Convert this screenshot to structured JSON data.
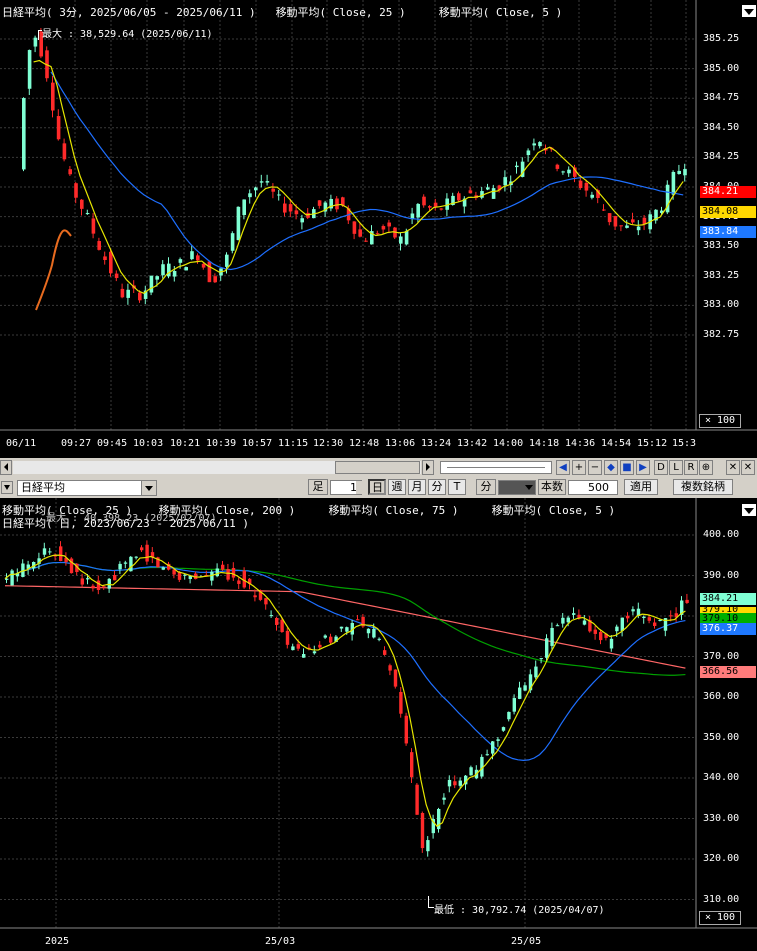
{
  "top_chart": {
    "legend": {
      "instrument": "日経平均( 3分, 2025/06/05 - 2025/06/11 )",
      "ma1": "移動平均( Close, 25 )",
      "ma2": "移動平均( Close, 5 )"
    },
    "max_annotation": "最大 : 38,529.64 (2025/06/11)",
    "y_ticks": [
      "385.25",
      "385.00",
      "384.75",
      "384.50",
      "384.25",
      "384.00",
      "383.75",
      "383.50",
      "383.25",
      "383.00",
      "382.75"
    ],
    "x_ticks": [
      "06/11",
      "09:27",
      "09:45",
      "10:03",
      "10:21",
      "10:39",
      "10:57",
      "11:15",
      "12:30",
      "12:48",
      "13:06",
      "13:24",
      "13:42",
      "14:00",
      "14:18",
      "14:36",
      "14:54",
      "15:12",
      "15:3"
    ],
    "scale_label": "× 100",
    "price_tags": {
      "close": "384.21",
      "ma5": "384.08",
      "ma25": "383.84"
    },
    "colors": {
      "up": "#7fffd4",
      "down": "#ff2a2a",
      "ma5": "#e6e600",
      "ma25": "#1e6fff",
      "close_tag": "#ff0000",
      "ma5_tag": "#ffd800",
      "ma25_tag": "#1e78ff"
    }
  },
  "toolbar": {
    "instrument_select": "日経平均",
    "foot_label": "足",
    "foot_value": "1",
    "period_day": "日",
    "period_week": "週",
    "period_month": "月",
    "period_minute": "分",
    "period_tick": "T",
    "count_label": "本数",
    "count_value": "500",
    "apply_button": "適用",
    "multi_button": "複数銘柄",
    "nav_buttons": [
      "D",
      "L",
      "R"
    ]
  },
  "bottom_chart": {
    "legend": {
      "ma1": "移動平均( Close, 25 )",
      "ma2": "移動平均( Close, 200 )",
      "ma3": "移動平均( Close, 75 )",
      "ma4": "移動平均( Close, 5 )",
      "instrument": "日経平均( 日, 2023/06/23 - 2025/06/11 )",
      "max_overlap": "最大 : 40,398.23 (2025/02/07)"
    },
    "min_annotation": "最低 : 30,792.74 (2025/04/07)",
    "y_ticks": [
      "400.00",
      "390.00",
      "380.00",
      "370.00",
      "360.00",
      "350.00",
      "340.00",
      "330.00",
      "320.00",
      "310.00"
    ],
    "x_ticks": [
      "2025",
      "25/03",
      "25/05"
    ],
    "scale_label": "× 100",
    "price_tags": {
      "close": "384.21",
      "ma5": "379.10",
      "ma25": "379.10",
      "ma75": "376.37",
      "ma200": "366.56"
    },
    "colors": {
      "up": "#7fffd4",
      "down": "#ff2a2a",
      "ma5": "#e6e600",
      "ma25": "#1e6fff",
      "ma75": "#00a000",
      "ma200": "#ff6666",
      "close_tag": "#7fffd4",
      "ma5_tag": "#ffd800",
      "ma75_tag": "#00b000",
      "ma25_tag": "#1e78ff",
      "ma200_tag": "#ff7b7b"
    }
  }
}
